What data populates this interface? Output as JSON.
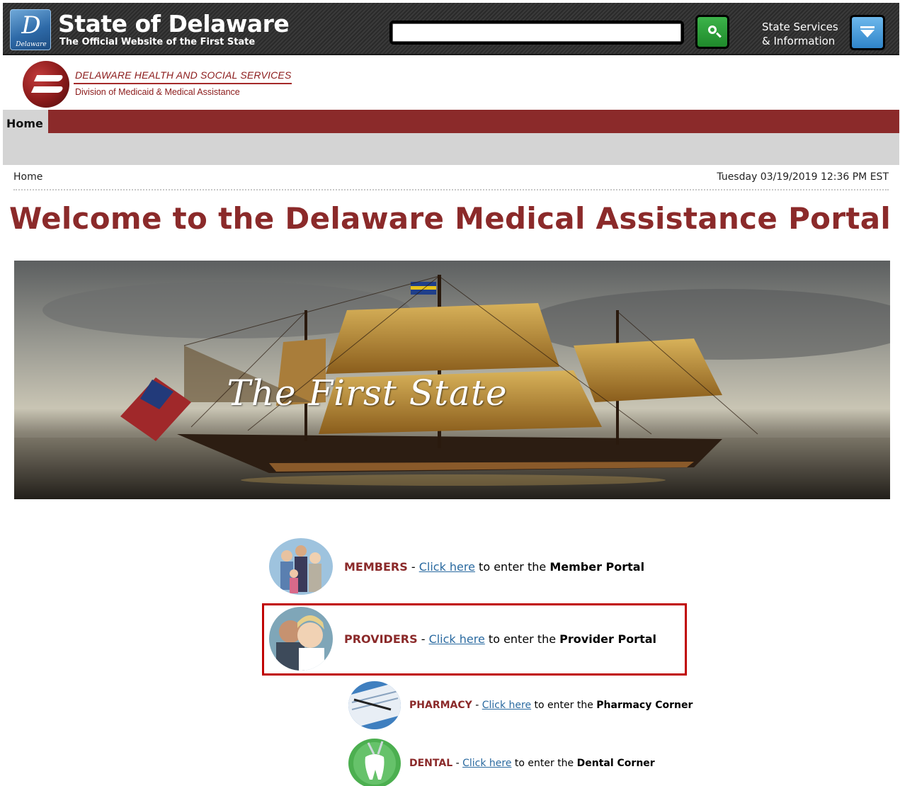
{
  "state_header": {
    "logo_glyph": "D",
    "logo_caption": "Delaware",
    "title": "State of Delaware",
    "subtitle": "The Official Website of the First State",
    "search_value": "",
    "services_line1": "State Services",
    "services_line2": "& Information"
  },
  "agency": {
    "name": "DELAWARE HEALTH AND SOCIAL SERVICES",
    "division": "Division of Medicaid & Medical Assistance"
  },
  "nav": {
    "home": "Home"
  },
  "breadcrumb": {
    "current": "Home",
    "datetime": "Tuesday 03/19/2019 12:36 PM EST"
  },
  "page": {
    "title": "Welcome to the Delaware Medical Assistance Portal"
  },
  "hero": {
    "caption": "The First State"
  },
  "portals": {
    "members": {
      "category": "MEMBERS",
      "separator": " - ",
      "link": "Click here",
      "mid": " to enter the ",
      "destination": "Member Portal"
    },
    "providers": {
      "category": "PROVIDERS",
      "separator": " - ",
      "link": "Click here",
      "mid": " to enter the ",
      "destination": "Provider Portal"
    },
    "pharmacy": {
      "category": "PHARMACY",
      "separator": " - ",
      "link": "Click here",
      "mid": " to enter the ",
      "destination": "Pharmacy Corner"
    },
    "dental": {
      "category": "DENTAL",
      "separator": " - ",
      "link": "Click here",
      "mid": " to enter the ",
      "destination": "Dental Corner"
    }
  },
  "colors": {
    "brand_red": "#8b2a2a",
    "link_blue": "#2a6aa0",
    "highlight_red": "#c00000",
    "search_green": "#2ca03a",
    "services_blue": "#3f93d4"
  },
  "icons": {
    "search": "magnifier-icon",
    "services": "chevron-down-icon"
  }
}
